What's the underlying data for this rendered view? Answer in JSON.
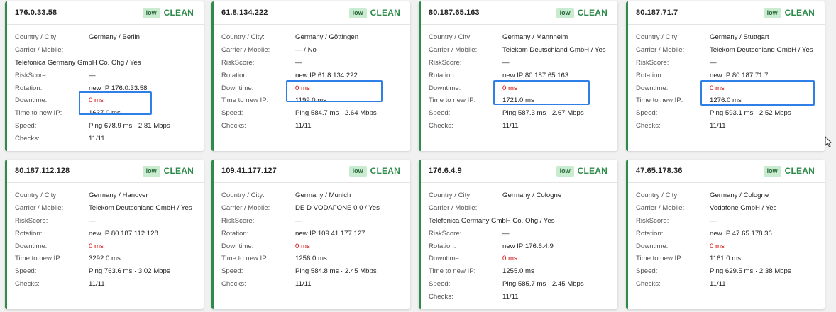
{
  "labels": {
    "country": "Country / City:",
    "carrier": "Carrier / Mobile:",
    "risk": "RiskScore:",
    "rotation": "Rotation:",
    "downtime": "Downtime:",
    "time_new_ip": "Time to new IP:",
    "speed": "Speed:",
    "checks": "Checks:"
  },
  "colors": {
    "accent": "#2e8b4a",
    "badge_bg": "#c9ecd1",
    "downtime": "#d00000",
    "highlight": "#2f7fe8"
  },
  "cards": [
    {
      "ip": "176.0.33.58",
      "badge": "low",
      "status": "CLEAN",
      "country": "Germany / Berlin",
      "carrier": "",
      "carrier_full": "Telefonica Germany GmbH Co. Ohg / Yes",
      "risk": "—",
      "rotation": "new IP 176.0.33.58",
      "downtime": "0 ms",
      "time_new_ip": "1637.0 ms",
      "speed": "Ping 678.9 ms · 2.81 Mbps",
      "checks": "11/11"
    },
    {
      "ip": "61.8.134.222",
      "badge": "low",
      "status": "CLEAN",
      "country": "Germany / Göttingen",
      "carrier": "— / No",
      "risk": "—",
      "rotation": "new IP 61.8.134.222",
      "downtime": "0 ms",
      "time_new_ip": "1199.0 ms",
      "speed": "Ping 584.7 ms · 2.64 Mbps",
      "checks": "11/11"
    },
    {
      "ip": "80.187.65.163",
      "badge": "low",
      "status": "CLEAN",
      "country": "Germany / Mannheim",
      "carrier": "Telekom Deutschland GmbH / Yes",
      "risk": "—",
      "rotation": "new IP 80.187.65.163",
      "downtime": "0 ms",
      "time_new_ip": "1721.0 ms",
      "speed": "Ping 587.3 ms · 2.67 Mbps",
      "checks": "11/11"
    },
    {
      "ip": "80.187.71.7",
      "badge": "low",
      "status": "CLEAN",
      "country": "Germany / Stuttgart",
      "carrier": "Telekom Deutschland GmbH / Yes",
      "risk": "—",
      "rotation": "new IP 80.187.71.7",
      "downtime": "0 ms",
      "time_new_ip": "1276.0 ms",
      "speed": "Ping 593.1 ms · 2.52 Mbps",
      "checks": "11/11"
    },
    {
      "ip": "80.187.112.128",
      "badge": "low",
      "status": "CLEAN",
      "country": "Germany / Hanover",
      "carrier": "Telekom Deutschland GmbH / Yes",
      "risk": "—",
      "rotation": "new IP 80.187.112.128",
      "downtime": "0 ms",
      "time_new_ip": "3292.0 ms",
      "speed": "Ping 763.6 ms · 3.02 Mbps",
      "checks": "11/11"
    },
    {
      "ip": "109.41.177.127",
      "badge": "low",
      "status": "CLEAN",
      "country": "Germany / Munich",
      "carrier": "DE D VODAFONE 0 0 / Yes",
      "risk": "—",
      "rotation": "new IP 109.41.177.127",
      "downtime": "0 ms",
      "time_new_ip": "1256.0 ms",
      "speed": "Ping 584.8 ms · 2.45 Mbps",
      "checks": "11/11"
    },
    {
      "ip": "176.6.4.9",
      "badge": "low",
      "status": "CLEAN",
      "country": "Germany / Cologne",
      "carrier": "",
      "carrier_full": "Telefonica Germany GmbH Co. Ohg / Yes",
      "risk": "—",
      "rotation": "new IP 176.6.4.9",
      "downtime": "0 ms",
      "time_new_ip": "1255.0 ms",
      "speed": "Ping 585.7 ms · 2.45 Mbps",
      "checks": "11/11"
    },
    {
      "ip": "47.65.178.36",
      "badge": "low",
      "status": "CLEAN",
      "country": "Germany / Cologne",
      "carrier": "Vodafone GmbH / Yes",
      "risk": "—",
      "rotation": "new IP 47.65.178.36",
      "downtime": "0 ms",
      "time_new_ip": "1161.0 ms",
      "speed": "Ping 629.5 ms · 2.38 Mbps",
      "checks": "11/11"
    }
  ]
}
